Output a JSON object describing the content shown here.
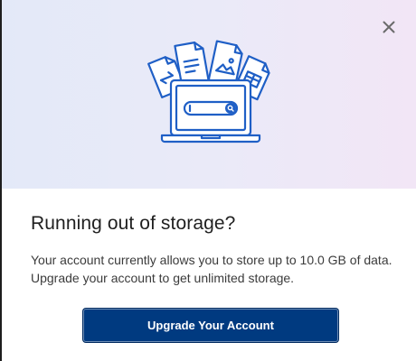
{
  "dialog": {
    "title": "Running out of storage?",
    "message": "Your account currently allows you to store up to 10.0 GB of data. Upgrade your account to get unlimited storage.",
    "button_label": "Upgrade Your Account",
    "close_icon": "close-icon"
  },
  "illustration": {
    "icons": [
      "laptop-icon",
      "search-bar-icon",
      "document-icon",
      "image-file-icon",
      "calendar-file-icon",
      "ticket-file-icon"
    ]
  },
  "colors": {
    "accent": "#003a80",
    "illustration_stroke": "#1f5fc6",
    "hero_gradient_start": "#e3e9f8",
    "hero_gradient_end": "#f2e6f6"
  }
}
